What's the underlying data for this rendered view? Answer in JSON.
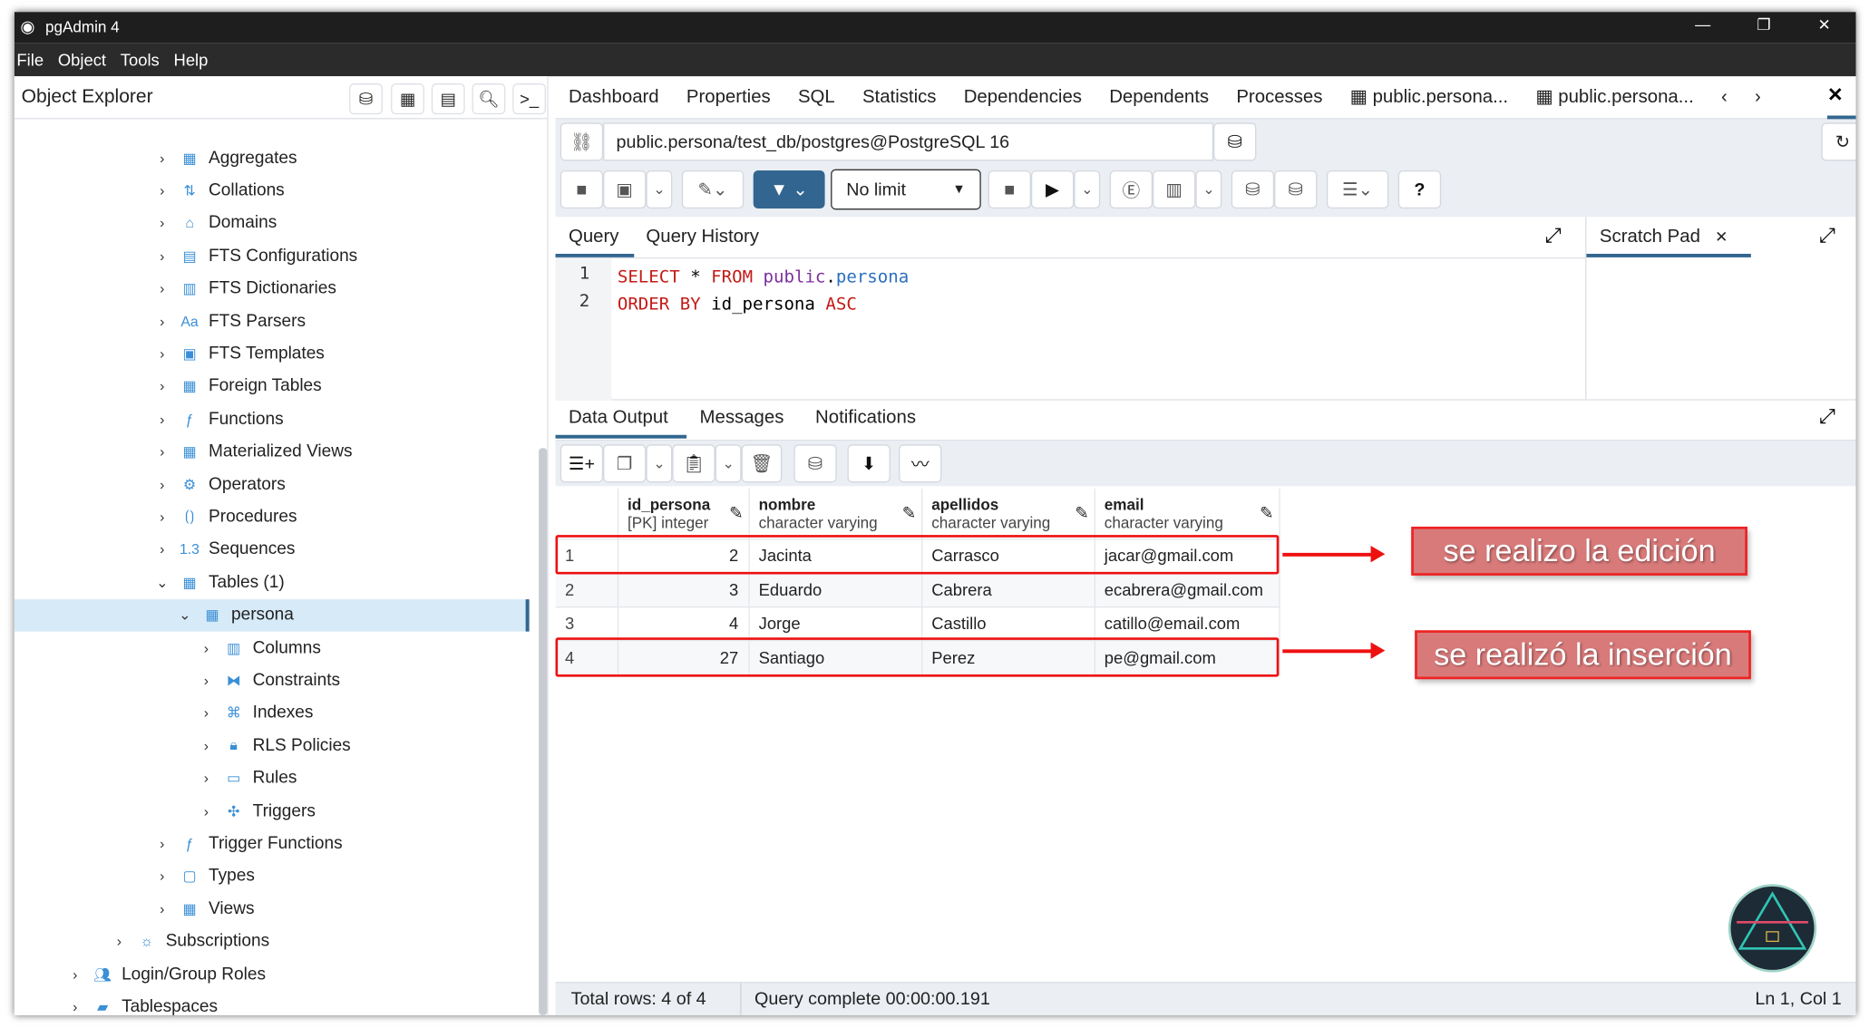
{
  "window": {
    "title": "pgAdmin 4",
    "controls": [
      "—",
      "❐",
      "✕"
    ]
  },
  "menu": [
    "File",
    "Object",
    "Tools",
    "Help"
  ],
  "object_explorer": {
    "title": "Object Explorer",
    "items": [
      {
        "label": "Aggregates",
        "level": 3,
        "icon": "aggregates-icon"
      },
      {
        "label": "Collations",
        "level": 3,
        "icon": "collations-icon"
      },
      {
        "label": "Domains",
        "level": 3,
        "icon": "domains-icon"
      },
      {
        "label": "FTS Configurations",
        "level": 3,
        "icon": "fts-configurations-icon"
      },
      {
        "label": "FTS Dictionaries",
        "level": 3,
        "icon": "fts-dictionaries-icon"
      },
      {
        "label": "FTS Parsers",
        "level": 3,
        "icon": "fts-parsers-icon"
      },
      {
        "label": "FTS Templates",
        "level": 3,
        "icon": "fts-templates-icon"
      },
      {
        "label": "Foreign Tables",
        "level": 3,
        "icon": "foreign-tables-icon"
      },
      {
        "label": "Functions",
        "level": 3,
        "icon": "functions-icon"
      },
      {
        "label": "Materialized Views",
        "level": 3,
        "icon": "materialized-views-icon"
      },
      {
        "label": "Operators",
        "level": 3,
        "icon": "operators-icon"
      },
      {
        "label": "Procedures",
        "level": 3,
        "icon": "procedures-icon"
      },
      {
        "label": "Sequences",
        "level": 3,
        "icon": "sequences-icon"
      },
      {
        "label": "Tables (1)",
        "level": 3,
        "icon": "tables-icon",
        "expanded": true
      },
      {
        "label": "persona",
        "level": 4,
        "icon": "table-icon",
        "expanded": true,
        "selected": true
      },
      {
        "label": "Columns",
        "level": 5,
        "icon": "columns-icon"
      },
      {
        "label": "Constraints",
        "level": 5,
        "icon": "constraints-icon"
      },
      {
        "label": "Indexes",
        "level": 5,
        "icon": "indexes-icon"
      },
      {
        "label": "RLS Policies",
        "level": 5,
        "icon": "rls-policies-icon"
      },
      {
        "label": "Rules",
        "level": 5,
        "icon": "rules-icon"
      },
      {
        "label": "Triggers",
        "level": 5,
        "icon": "triggers-icon"
      },
      {
        "label": "Trigger Functions",
        "level": 3,
        "icon": "trigger-functions-icon"
      },
      {
        "label": "Types",
        "level": 3,
        "icon": "types-icon"
      },
      {
        "label": "Views",
        "level": 3,
        "icon": "views-icon"
      },
      {
        "label": "Subscriptions",
        "level": 2,
        "icon": "subscriptions-icon"
      },
      {
        "label": "Login/Group Roles",
        "level": 1,
        "icon": "login-roles-icon"
      },
      {
        "label": "Tablespaces",
        "level": 1,
        "icon": "tablespaces-icon"
      }
    ]
  },
  "tabs": [
    "Dashboard",
    "Properties",
    "SQL",
    "Statistics",
    "Dependencies",
    "Dependents",
    "Processes",
    "public.persona...",
    "public.persona..."
  ],
  "connection": "public.persona/test_db/postgres@PostgreSQL 16",
  "limit": "No limit",
  "query_tabs": [
    "Query",
    "Query History"
  ],
  "scratch_pad": "Scratch Pad",
  "editor": {
    "lines": [
      "1",
      "2"
    ]
  },
  "output_tabs": [
    "Data Output",
    "Messages",
    "Notifications"
  ],
  "grid": {
    "columns": [
      {
        "name": "id_persona",
        "type": "[PK] integer"
      },
      {
        "name": "nombre",
        "type": "character varying"
      },
      {
        "name": "apellidos",
        "type": "character varying"
      },
      {
        "name": "email",
        "type": "character varying"
      }
    ],
    "rows": [
      [
        "1",
        "2",
        "Jacinta",
        "Carrasco",
        "jacar@gmail.com"
      ],
      [
        "2",
        "3",
        "Eduardo",
        "Cabrera",
        "ecabrera@gmail.com"
      ],
      [
        "3",
        "4",
        "Jorge",
        "Castillo",
        "catillo@email.com"
      ],
      [
        "4",
        "27",
        "Santiago",
        "Perez",
        "pe@gmail.com"
      ]
    ]
  },
  "annotations": [
    "se realizo la edición",
    "se realizó la inserción"
  ],
  "status": {
    "rows": "Total rows: 4 of 4",
    "query": "Query complete 00:00:00.191",
    "position": "Ln 1, Col 1"
  },
  "colors": {
    "accent": "#326690",
    "highlight": "#ee1111",
    "callout": "#d97a7a",
    "keyword": "#c41a16"
  }
}
